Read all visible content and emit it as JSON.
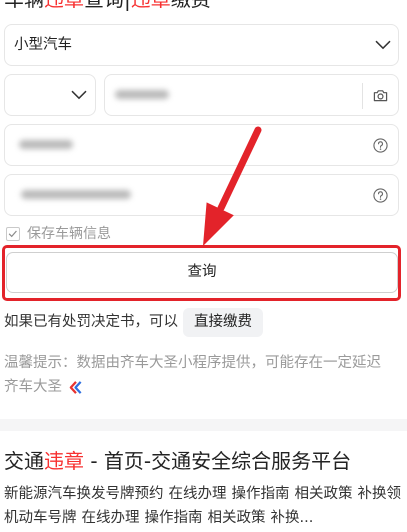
{
  "header": {
    "t1": "车辆",
    "k1": "违章",
    "t2": "查询|",
    "k2": "违章",
    "t3": "缴费"
  },
  "form": {
    "vehicle_type": "小型汽车",
    "save_vehicle_label": "保存车辆信息",
    "save_vehicle_checked": true,
    "submit_label": "查询"
  },
  "payment": {
    "prompt": "如果已有处罚决定书，可以",
    "button_label": "直接缴费"
  },
  "notice": {
    "text": "温馨提示：数据由齐车大圣小程序提供，可能存在一定延迟",
    "source": "齐车大圣"
  },
  "result": {
    "title_t1": "交通",
    "title_kw": "违章",
    "title_t2": " - 首页-交通安全综合服务平台",
    "lines": [
      [
        "新能源汽车换发号牌预约",
        "在线办理",
        "操作指南",
        "相关政策",
        "补换领"
      ],
      [
        "机动车号牌",
        "在线办理",
        "操作指南",
        "相关政策",
        "补换..."
      ]
    ]
  },
  "colors": {
    "keyword": "#f73131",
    "annotation": "#e3232a"
  },
  "icons": {
    "select_arrow": "chevron-down-icon",
    "plate_scan": "camera-icon",
    "field_help": "question-circle-icon",
    "checkbox": "checkmark-icon",
    "source_logo": "brand-logo-icon"
  }
}
